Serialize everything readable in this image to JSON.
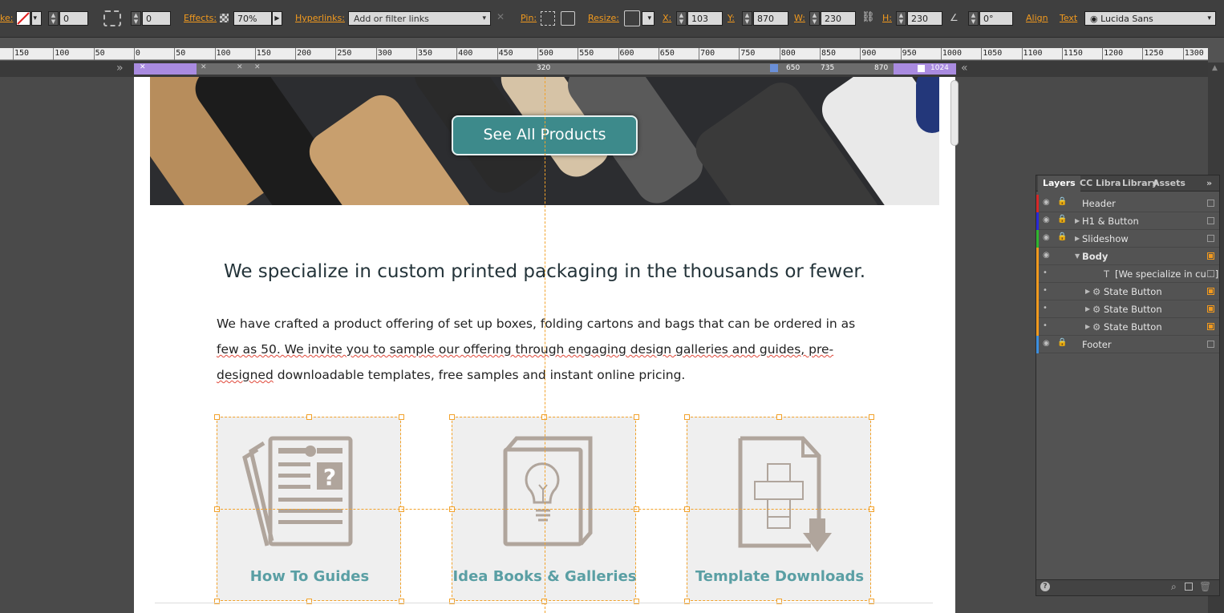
{
  "toolbar": {
    "stroke_label": "ke:",
    "stroke_weight": "0",
    "corner_value": "0",
    "effects_label": "Effects:",
    "effects_value": "70%",
    "hyperlinks_label": "Hyperlinks:",
    "hyperlinks_placeholder": "Add or filter links",
    "pin_label": "Pin:",
    "resize_label": "Resize:",
    "x_label": "X:",
    "x_value": "103",
    "y_label": "Y:",
    "y_value": "870",
    "w_label": "W:",
    "w_value": "230",
    "h_label": "H:",
    "h_value": "230",
    "rotation_value": "0°",
    "align_label": "Align",
    "text_label": "Text",
    "font_value": "Lucida Sans"
  },
  "ruler": {
    "labels": [
      "150",
      "100",
      "50",
      "0",
      "50",
      "100",
      "150",
      "200",
      "250",
      "300",
      "350",
      "400",
      "450",
      "500",
      "550",
      "600",
      "650",
      "700",
      "750",
      "800",
      "850",
      "900",
      "950",
      "1000",
      "1050",
      "1100",
      "1150",
      "1200",
      "1250",
      "1300"
    ]
  },
  "breakpoints": {
    "center_value": "320",
    "bp_650": "650",
    "bp_735": "735",
    "bp_870": "870",
    "bp_1024": "1024"
  },
  "page": {
    "cta_label": "See All Products",
    "headline": "We specialize in custom printed packaging in the thousands or fewer.",
    "para_1": "We have crafted a product offering of set up boxes, folding cartons and bags that can be ordered in as",
    "para_2a": "few as 50. We invite you to sample our offering through engaging design galleries and guides, pre-",
    "para_3a": "designed",
    "para_3b": " downloadable templates, free samples and instant online pricing.",
    "cards": [
      {
        "label": "How To Guides",
        "icon": "guides-icon"
      },
      {
        "label": "Idea Books & Galleries",
        "icon": "idea-book-icon"
      },
      {
        "label": "Template Downloads",
        "icon": "template-download-icon"
      }
    ]
  },
  "layers_panel": {
    "tabs": [
      "Layers",
      "CC Libra",
      "Library",
      "Assets"
    ],
    "rows": [
      {
        "label": "Header",
        "color": "#d62828",
        "lock": true,
        "expand": false,
        "indent": 0
      },
      {
        "label": "H1 & Button",
        "color": "#2929d9",
        "lock": true,
        "expand": true,
        "indent": 0
      },
      {
        "label": "Slideshow",
        "color": "#2fb52f",
        "lock": true,
        "expand": true,
        "indent": 0
      },
      {
        "label": "Body",
        "color": "#f29a1e",
        "lock": false,
        "expand": true,
        "indent": 0
      },
      {
        "label": "[We specialize in cu...]",
        "color": "#f29a1e",
        "lock": false,
        "expand": false,
        "indent": 2
      },
      {
        "label": "State Button",
        "color": "#f29a1e",
        "lock": false,
        "expand": true,
        "indent": 1
      },
      {
        "label": "State Button",
        "color": "#f29a1e",
        "lock": false,
        "expand": true,
        "indent": 1
      },
      {
        "label": "State Button",
        "color": "#f29a1e",
        "lock": false,
        "expand": true,
        "indent": 1
      },
      {
        "label": "Footer",
        "color": "#3c8fe0",
        "lock": true,
        "expand": false,
        "indent": 0
      }
    ]
  },
  "colors": {
    "accent": "#f29a1e",
    "teal": "#3d8a8b",
    "card_label": "#5a9fa4",
    "icon": "#b0a59c"
  }
}
